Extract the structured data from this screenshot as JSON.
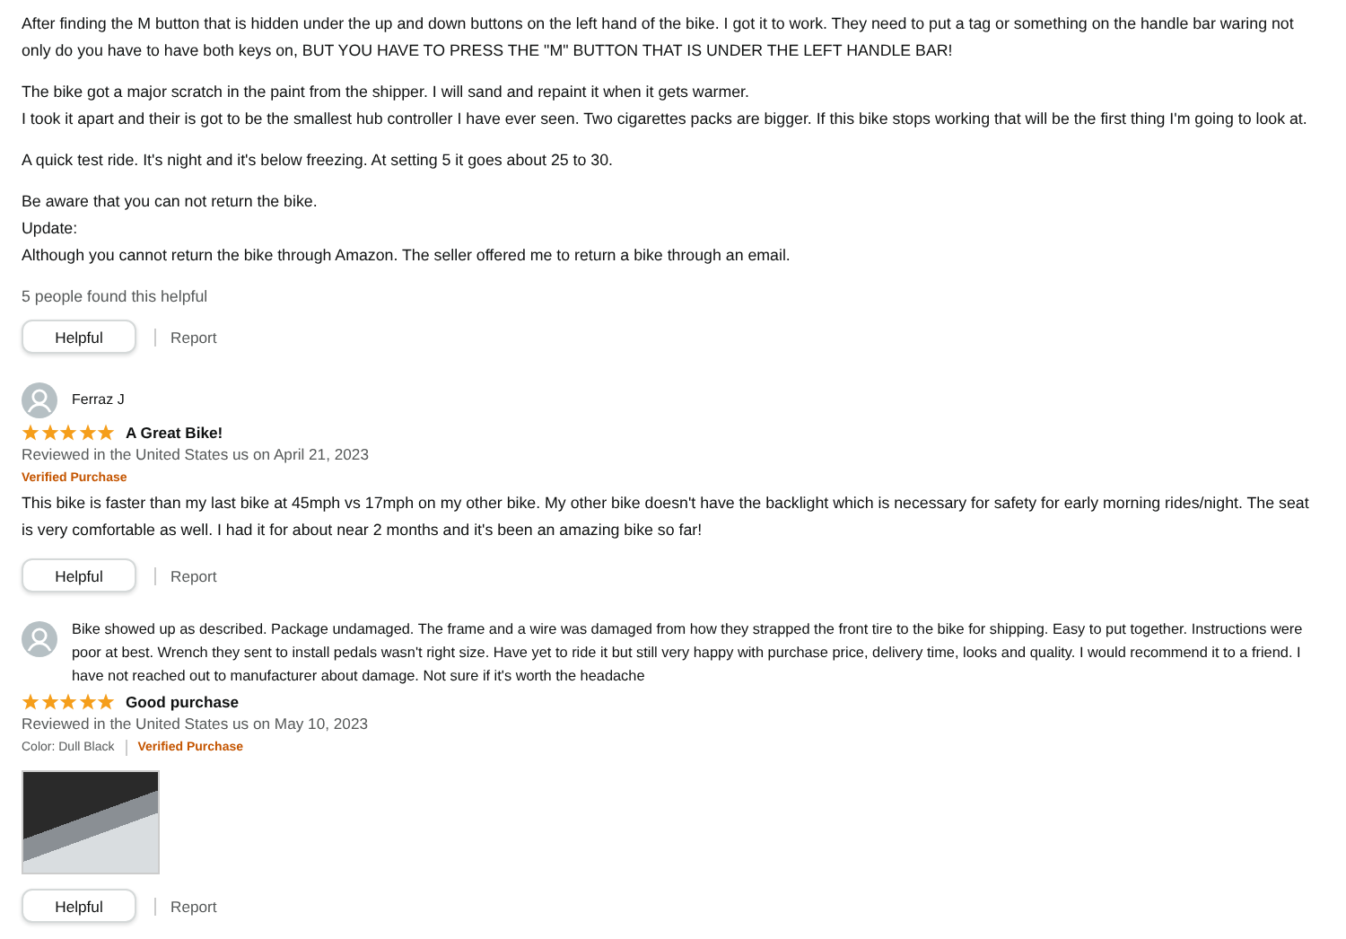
{
  "reviews": [
    {
      "body": [
        [
          "After finding the M button that is hidden under the up and down buttons on the left hand of the bike. I got it to work. They need to put a tag or something on the handle bar waring not only do you have to have both keys on, BUT YOU HAVE TO PRESS THE \"M\" BUTTON THAT IS UNDER THE LEFT HANDLE BAR!"
        ],
        [
          "The bike got a major scratch in the paint from the shipper. I will sand and repaint it when it gets warmer.",
          "I took it apart and their is got to be the smallest hub controller I have ever seen. Two cigarettes packs are bigger. If this bike stops working that will be the first thing I'm going to look at."
        ],
        [
          "A quick test ride. It's night and it's below freezing. At setting 5 it goes about 25 to 30."
        ],
        [
          "Be aware that you can not return the bike.",
          "Update:",
          "Although you cannot return the bike through Amazon. The seller offered me to return a bike through an email."
        ]
      ],
      "helpful_count": "5 people found this helpful",
      "helpful_button": "Helpful",
      "report": "Report"
    },
    {
      "author": "Ferraz J",
      "stars": 5,
      "title": "A Great Bike!",
      "date": "Reviewed in the United States us on April 21, 2023",
      "verified_label": "Verified Purchase",
      "body": [
        [
          "This bike is faster than my last bike at 45mph vs 17mph on my other bike. My other bike doesn't have the backlight which is necessary for safety for early morning rides/night. The seat is very comfortable as well. I had it for about near 2 months and it's been an amazing bike so far!"
        ]
      ],
      "helpful_button": "Helpful",
      "report": "Report"
    },
    {
      "avatar_text": "Bike showed up as described. Package undamaged. The frame and a wire was damaged from how they strapped the front tire to the bike for shipping. Easy to put together. Instructions were poor at best. Wrench they sent to install pedals wasn't right size. Have yet to ride it but still very happy with purchase price, delivery time, looks and quality. I would recommend it to a friend. I have not reached out to manufacturer about damage. Not sure if it's worth the headache",
      "stars": 5,
      "title": "Good purchase",
      "date": "Reviewed in the United States us on May 10, 2023",
      "color_label": "Color: Dull Black",
      "verified_label": "Verified Purchase",
      "image": true,
      "helpful_button": "Helpful",
      "report": "Report"
    }
  ]
}
